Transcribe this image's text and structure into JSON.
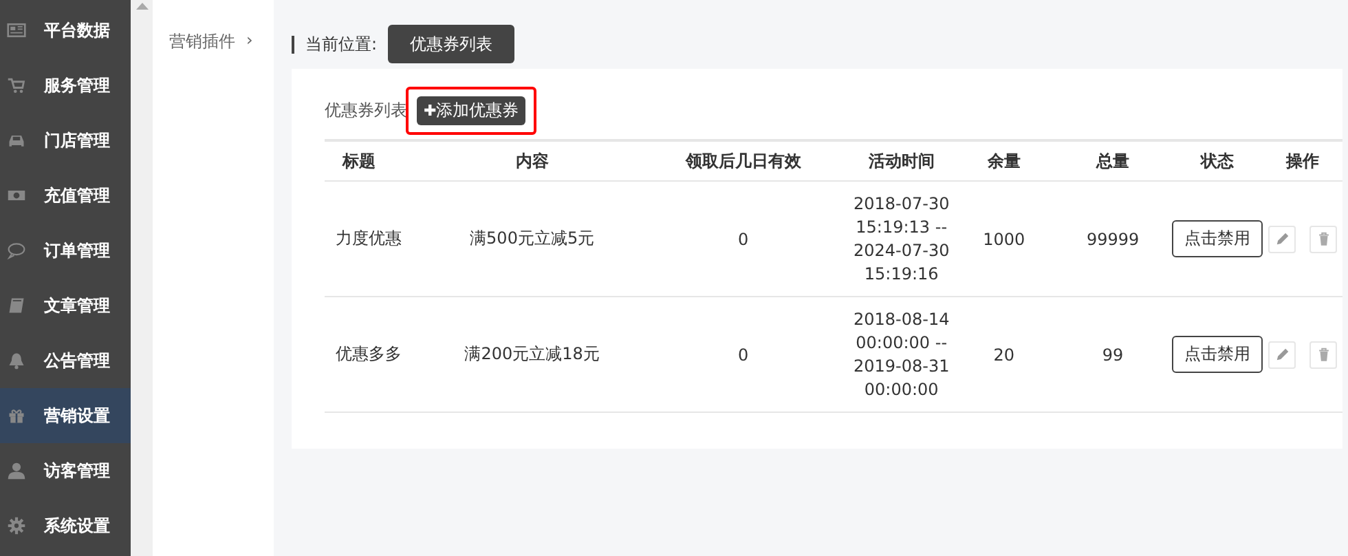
{
  "sidebar": {
    "items": [
      {
        "label": "平台数据",
        "selected": false
      },
      {
        "label": "服务管理",
        "selected": false
      },
      {
        "label": "门店管理",
        "selected": false
      },
      {
        "label": "充值管理",
        "selected": false
      },
      {
        "label": "订单管理",
        "selected": false
      },
      {
        "label": "文章管理",
        "selected": false
      },
      {
        "label": "公告管理",
        "selected": false
      },
      {
        "label": "营销设置",
        "selected": true
      },
      {
        "label": "访客管理",
        "selected": false
      },
      {
        "label": "系统设置",
        "selected": false
      }
    ]
  },
  "submenu": {
    "items": [
      {
        "label": "营销插件",
        "arrow": "›"
      }
    ]
  },
  "breadcrumb": {
    "label": "当前位置:",
    "current": "优惠券列表"
  },
  "panel": {
    "title": "优惠券列表",
    "add_button": {
      "icon": "✚",
      "label": "添加优惠券",
      "highlighted": true
    }
  },
  "table": {
    "columns": [
      "标题",
      "内容",
      "领取后几日有效",
      "活动时间",
      "余量",
      "总量",
      "状态",
      "操作"
    ],
    "rows": [
      {
        "title": "力度优惠",
        "content": "满500元立减5元",
        "valid_days": "0",
        "time": [
          "2018-07-30",
          "15:19:13 --",
          "2024-07-30",
          "15:19:16"
        ],
        "remaining": "1000",
        "total": "99999",
        "status_button": "点击禁用"
      },
      {
        "title": "优惠多多",
        "content": "满200元立减18元",
        "valid_days": "0",
        "time": [
          "2018-08-14",
          "00:00:00 --",
          "2019-08-31",
          "00:00:00"
        ],
        "remaining": "20",
        "total": "99",
        "status_button": "点击禁用"
      }
    ]
  }
}
